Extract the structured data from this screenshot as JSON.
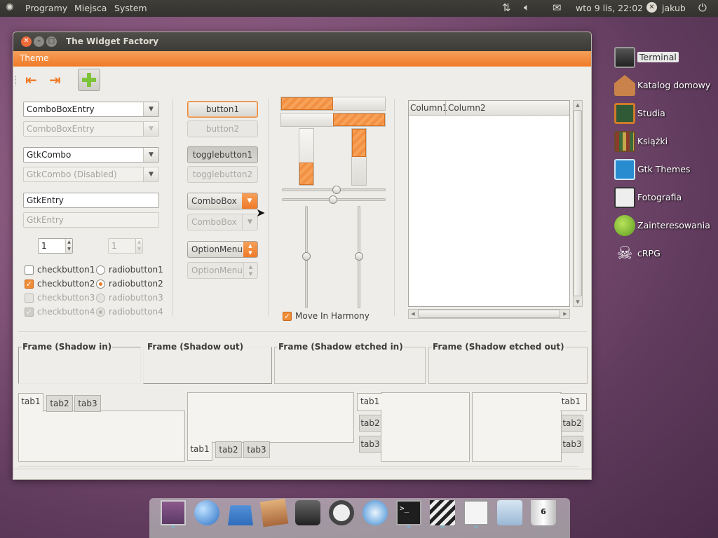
{
  "panel": {
    "menu_programs": "Programy",
    "menu_places": "Miejsca",
    "menu_system": "System",
    "clock": "wto  9 lis, 22:02",
    "user": "jakub"
  },
  "window": {
    "title": "The Widget Factory",
    "menu_theme": "Theme"
  },
  "col1": {
    "combo_entry": "ComboBoxEntry",
    "combo_entry_dis": "ComboBoxEntry",
    "gtk_combo": "GtkCombo",
    "gtk_combo_dis": "GtkCombo (Disabled)",
    "gtk_entry": "GtkEntry",
    "gtk_entry_dis": "GtkEntry",
    "spin1": "1",
    "spin2": "1",
    "check1": "checkbutton1",
    "check2": "checkbutton2",
    "check3": "checkbutton3",
    "check4": "checkbutton4",
    "radio1": "radiobutton1",
    "radio2": "radiobutton2",
    "radio3": "radiobutton3",
    "radio4": "radiobutton4"
  },
  "col2": {
    "button1": "button1",
    "button2": "button2",
    "toggle1": "togglebutton1",
    "toggle2": "togglebutton2",
    "combobox1": "ComboBox",
    "combobox2": "ComboBox",
    "optionmenu1": "OptionMenu",
    "optionmenu2": "OptionMenu"
  },
  "col3": {
    "move_in_harmony": "Move In Harmony",
    "hbar1_progress": 0.5,
    "hbar2_progress": 0.5,
    "vbar1_progress": 0.4,
    "vbar2_progress": 0.5
  },
  "tree": {
    "col1": "Column1",
    "col2": "Column2"
  },
  "frames": {
    "shadow_in": "Frame (Shadow in)",
    "shadow_out": "Frame (Shadow out)",
    "etched_in": "Frame (Shadow etched in)",
    "etched_out": "Frame (Shadow etched out)"
  },
  "tabs": {
    "t1": "tab1",
    "t2": "tab2",
    "t3": "tab3"
  },
  "desktop": [
    {
      "label": "Terminal"
    },
    {
      "label": "Katalog domowy"
    },
    {
      "label": "Studia"
    },
    {
      "label": "Książki"
    },
    {
      "label": "Gtk Themes"
    },
    {
      "label": "Fotografia"
    },
    {
      "label": "Zainteresowania"
    },
    {
      "label": "cRPG"
    }
  ],
  "dock": {
    "trash_count": "6"
  }
}
